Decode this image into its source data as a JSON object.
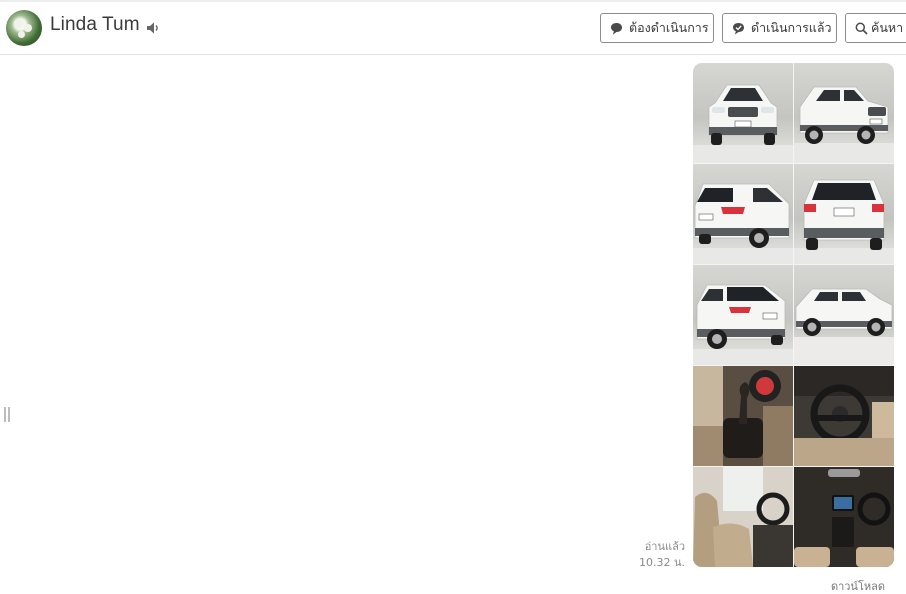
{
  "header": {
    "contact_name": "Linda Tum",
    "buttons": {
      "todo": "ต้องดำเนินการ",
      "done": "ดำเนินการแล้ว",
      "search": "ค้นหา"
    }
  },
  "message": {
    "read_status": "อ่านแล้ว",
    "time": "10.32 น.",
    "download": "ดาวน์โหลด",
    "photos": [
      {
        "kind": "exterior",
        "view": "car-front"
      },
      {
        "kind": "exterior",
        "view": "car-front-three-quarter"
      },
      {
        "kind": "exterior",
        "view": "car-rear-three-quarter"
      },
      {
        "kind": "exterior",
        "view": "car-rear"
      },
      {
        "kind": "exterior",
        "view": "car-rear-three-quarter"
      },
      {
        "kind": "exterior",
        "view": "car-side"
      },
      {
        "kind": "interior",
        "view": "gear-shifter"
      },
      {
        "kind": "interior",
        "view": "steering-wheel"
      },
      {
        "kind": "interior",
        "view": "front-seats"
      },
      {
        "kind": "interior",
        "view": "dashboard"
      }
    ]
  },
  "icons": [
    "speaker-icon",
    "chat-bubble-icon",
    "chat-check-icon",
    "search-icon",
    "drag-handle-icon"
  ],
  "colors": {
    "text": "#3b3b3b",
    "muted": "#8a8a8a",
    "border": "#8c8c8c",
    "car_white": "#f4f4f4",
    "tail_light": "#d8323a"
  }
}
